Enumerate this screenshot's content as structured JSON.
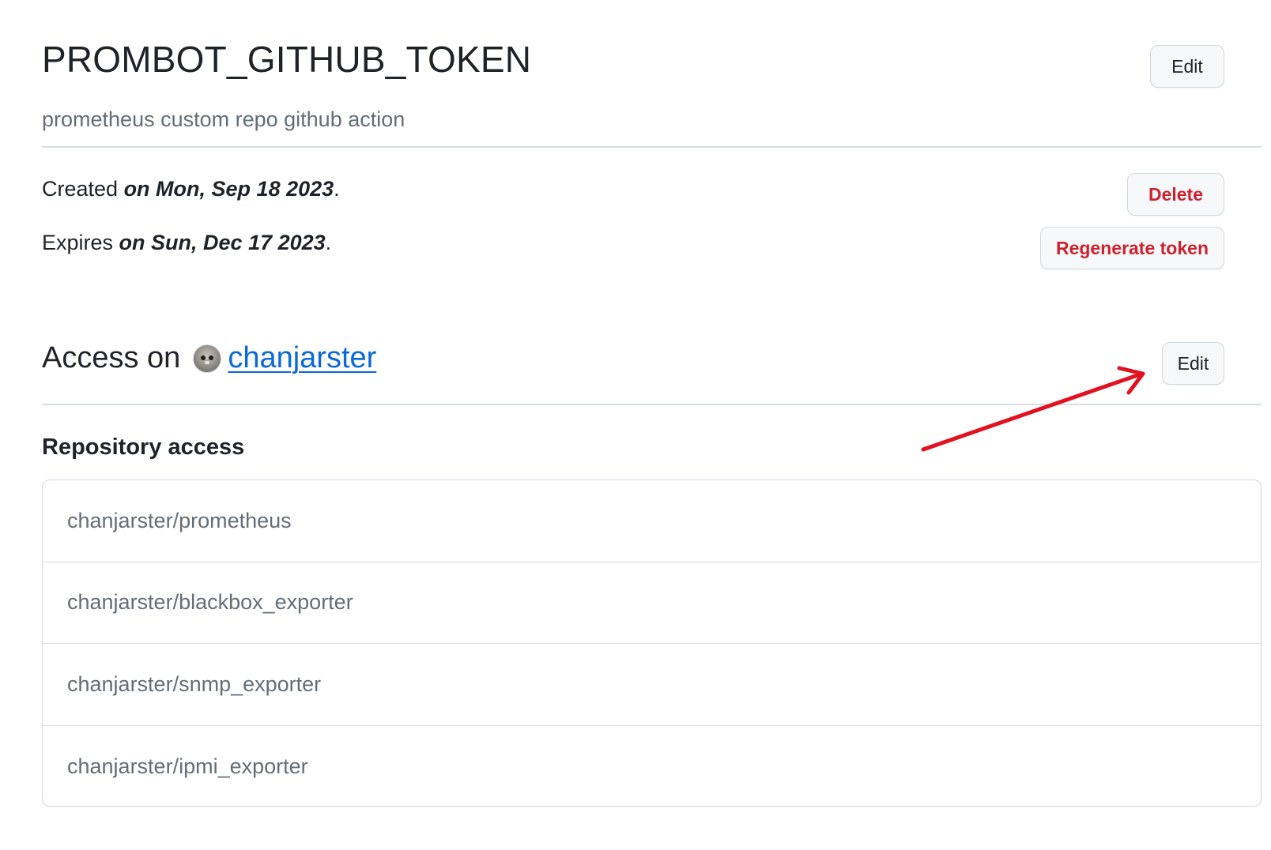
{
  "token": {
    "name": "PROMBOT_GITHUB_TOKEN",
    "description": "prometheus custom repo github action",
    "edit_label": "Edit"
  },
  "dates": {
    "created_prefix": "Created ",
    "created_value": "on Mon, Sep 18 2023",
    "expires_prefix": "Expires ",
    "expires_value": "on Sun, Dec 17 2023",
    "period": "."
  },
  "actions": {
    "delete_label": "Delete",
    "regenerate_label": "Regenerate token"
  },
  "access": {
    "heading": "Access on",
    "owner": "chanjarster",
    "edit_label": "Edit"
  },
  "repositories": {
    "heading": "Repository access",
    "items": [
      "chanjarster/prometheus",
      "chanjarster/blackbox_exporter",
      "chanjarster/snmp_exporter",
      "chanjarster/ipmi_exporter"
    ]
  },
  "colors": {
    "danger": "#cf222e",
    "link": "#0969da",
    "muted_text": "#656d76",
    "annotation_arrow": "#e3111f"
  },
  "icons": {
    "avatar": "cat-avatar-icon",
    "annotation": "red-arrow-annotation"
  }
}
